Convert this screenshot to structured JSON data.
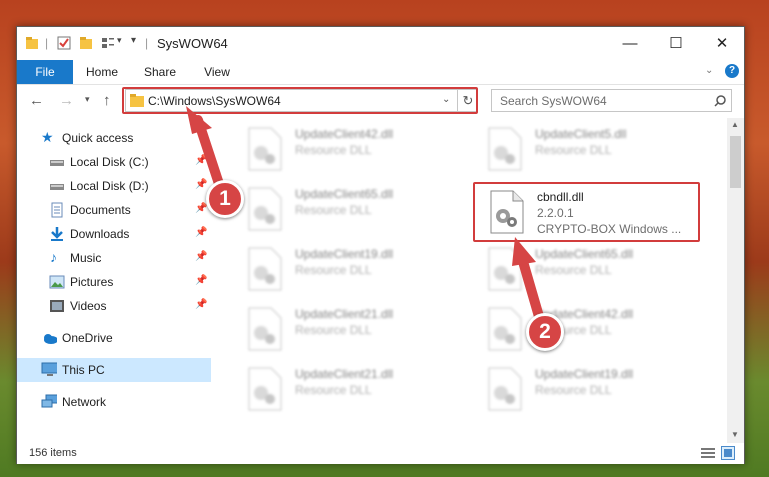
{
  "window": {
    "title": "SysWOW64"
  },
  "ribbon": {
    "tabs": [
      "File",
      "Home",
      "Share",
      "View"
    ]
  },
  "address": {
    "path": "C:\\Windows\\SysWOW64",
    "search_placeholder": "Search SysWOW64"
  },
  "nav": {
    "items": [
      {
        "label": "Quick access",
        "icon": "star-icon",
        "pinned": false
      },
      {
        "label": "Local Disk (C:)",
        "icon": "drive-icon",
        "pinned": true
      },
      {
        "label": "Local Disk (D:)",
        "icon": "drive-icon",
        "pinned": true
      },
      {
        "label": "Documents",
        "icon": "documents-icon",
        "pinned": true
      },
      {
        "label": "Downloads",
        "icon": "download-icon",
        "pinned": true
      },
      {
        "label": "Music",
        "icon": "music-icon",
        "pinned": true
      },
      {
        "label": "Pictures",
        "icon": "pictures-icon",
        "pinned": true
      },
      {
        "label": "Videos",
        "icon": "videos-icon",
        "pinned": true
      },
      {
        "label": "OneDrive",
        "icon": "cloud-icon",
        "pinned": false
      },
      {
        "label": "This PC",
        "icon": "computer-icon",
        "pinned": false,
        "selected": true
      },
      {
        "label": "Network",
        "icon": "network-icon",
        "pinned": false
      }
    ]
  },
  "files": [
    {
      "name": "UpdateClient42.dll",
      "line1": "Resource DLL",
      "line2": ""
    },
    {
      "name": "UpdateClient5.dll",
      "line1": "Resource DLL",
      "line2": ""
    },
    {
      "name": "UpdateClient65.dll",
      "line1": "Resource DLL",
      "line2": ""
    },
    {
      "name": "cbndll.dll",
      "line1": "2.2.0.1",
      "line2": "CRYPTO-BOX Windows ..."
    },
    {
      "name": "UpdateClient19.dll",
      "line1": "Resource DLL",
      "line2": ""
    },
    {
      "name": "UpdateClient65.dll",
      "line1": "Resource DLL",
      "line2": ""
    },
    {
      "name": "UpdateClient21.dll",
      "line1": "Resource DLL",
      "line2": ""
    },
    {
      "name": "UpdateClient42.dll",
      "line1": "Resource DLL",
      "line2": ""
    },
    {
      "name": "UpdateClient21.dll",
      "line1": "Resource DLL",
      "line2": ""
    },
    {
      "name": "UpdateClient19.dll",
      "line1": "Resource DLL",
      "line2": ""
    }
  ],
  "status": {
    "item_count": "156 items"
  },
  "annotations": {
    "step1": "1",
    "step2": "2",
    "color": "#d64545"
  }
}
